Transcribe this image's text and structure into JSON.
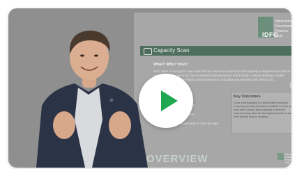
{
  "video": {
    "play_label": "Play video",
    "slide": {
      "logo_abbr": "IDFC",
      "logo_org": "International Development Finance Club",
      "section_title": "Capacity Scan",
      "why_heading": "What? Why? How?",
      "body_text": "IDFC aims to recognize how much human resources and technical capacity is required and what is the overall capacity needs for the successful implementation of the bank's climate strategy. Further analysis of the climate-related assessment tools and data requirements will need to be...",
      "items": [
        "capacities",
        "resources",
        "quirements to close the gaps"
      ],
      "key_outcomes_heading": "Key Outcomes",
      "key_outcomes_text": "Clear understanding of internal staff resources including potential capacities available to build, and what other actions and programs of external resources may arise for the implementation of bank-wide climate finance strategy.",
      "footer_word": "OVERVIEW",
      "footer_org": "International Development Finance Club"
    },
    "colors": {
      "play_icon": "#1fa84f",
      "header_bar": "#4f6f5e",
      "overlay": "#8f8f8f"
    }
  }
}
